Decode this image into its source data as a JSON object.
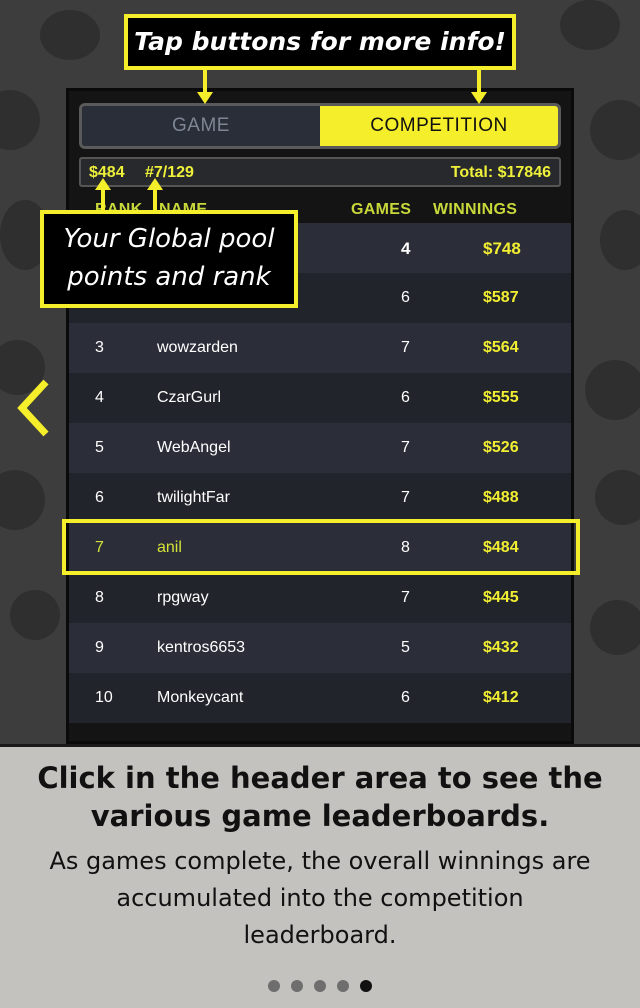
{
  "callouts": {
    "top": "Tap buttons for more info!",
    "left_line1": "Your Global pool",
    "left_line2": "points and rank"
  },
  "tabs": {
    "game": "GAME",
    "competition": "COMPETITION",
    "selected": "COMPETITION"
  },
  "info_bar": {
    "points": "$484",
    "rank": "#7/129",
    "total": "Total: $17846"
  },
  "columns": {
    "rank": "RANK",
    "name": "NAME",
    "games": "GAMES",
    "winnings": "WINNINGS"
  },
  "rows": [
    {
      "rank": "",
      "name": "",
      "games": "4",
      "winnings": "$748"
    },
    {
      "rank": "",
      "name": "",
      "games": "6",
      "winnings": "$587"
    },
    {
      "rank": "3",
      "name": "wowzarden",
      "games": "7",
      "winnings": "$564"
    },
    {
      "rank": "4",
      "name": "CzarGurl",
      "games": "6",
      "winnings": "$555"
    },
    {
      "rank": "5",
      "name": "WebAngel",
      "games": "7",
      "winnings": "$526"
    },
    {
      "rank": "6",
      "name": "twilightFar",
      "games": "7",
      "winnings": "$488"
    },
    {
      "rank": "7",
      "name": "anil",
      "games": "8",
      "winnings": "$484"
    },
    {
      "rank": "8",
      "name": "rpgway",
      "games": "7",
      "winnings": "$445"
    },
    {
      "rank": "9",
      "name": "kentros6653",
      "games": "5",
      "winnings": "$432"
    },
    {
      "rank": "10",
      "name": "Monkeycant",
      "games": "6",
      "winnings": "$412"
    }
  ],
  "highlighted_rank": "7",
  "caption": {
    "title_line1": "Click in the header area to see the",
    "title_line2": "various game leaderboards.",
    "body_line1": "As games complete, the overall winnings are",
    "body_line2": "accumulated into the competition",
    "body_line3": "leaderboard."
  },
  "pager": {
    "count": 5,
    "active_index": 4
  },
  "icons": {
    "back": "chevron-left-icon"
  },
  "colors": {
    "accent": "#f5ee2a",
    "row_odd": "#2b2e38",
    "row_even": "#22242b",
    "caption_bg": "#c4c2be"
  }
}
